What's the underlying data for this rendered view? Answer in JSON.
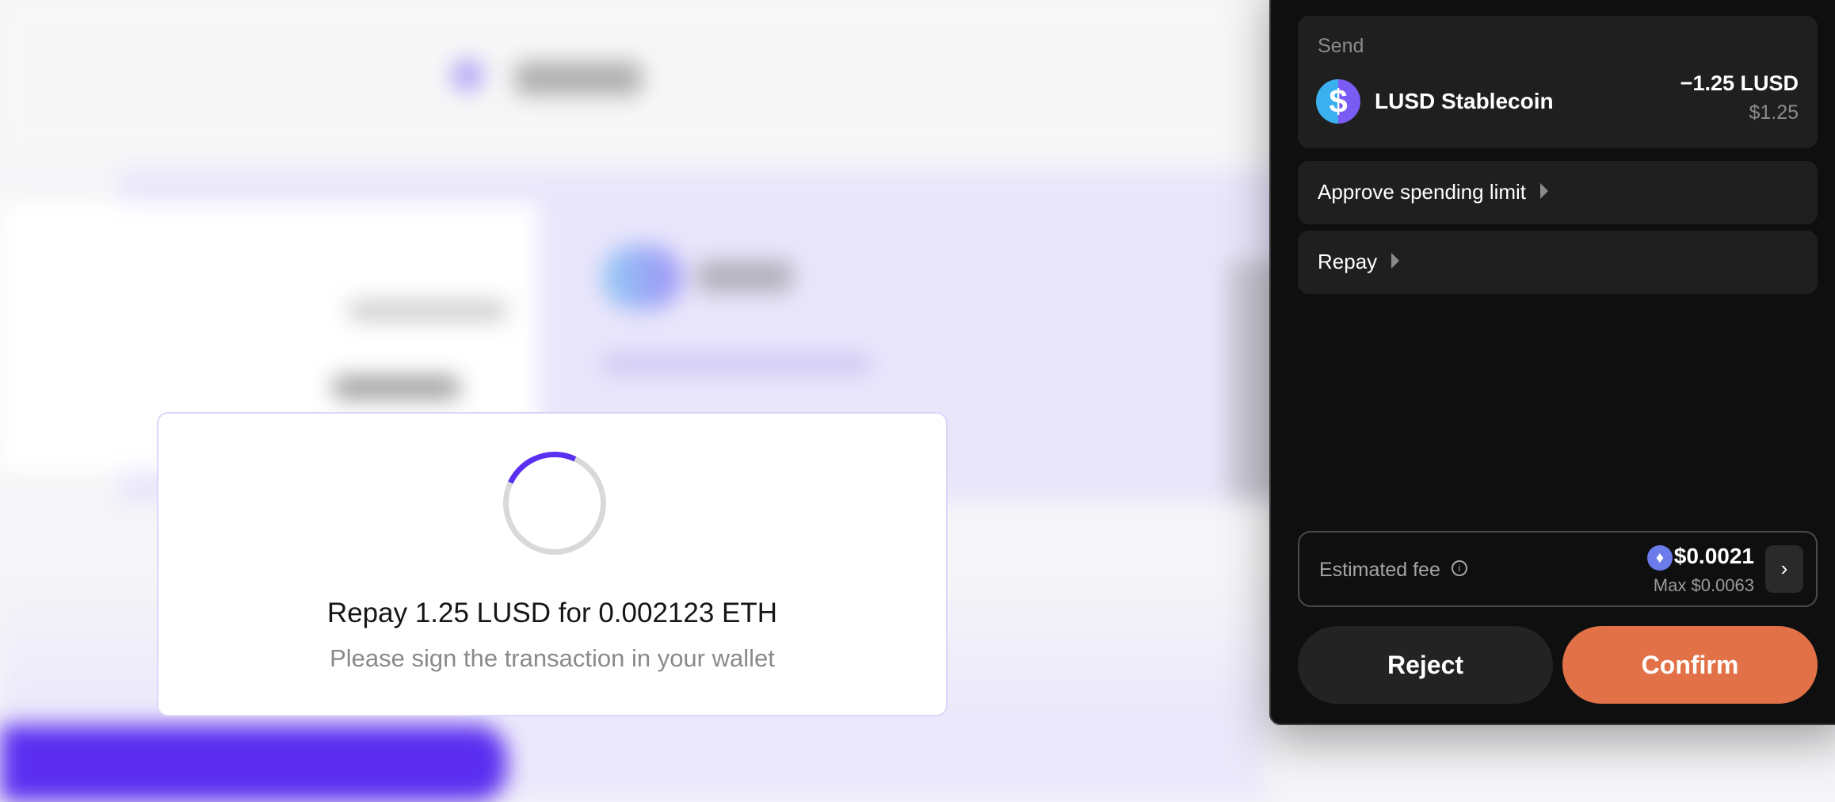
{
  "modal": {
    "title": "Repay 1.25 LUSD for 0.002123 ETH",
    "subtitle": "Please sign the transaction in your wallet"
  },
  "wallet": {
    "send_label": "Send",
    "token": {
      "icon": "dollar-icon",
      "symbol_glyph": "$",
      "name": "LUSD Stablecoin",
      "amount": "−1.25 LUSD",
      "usd": "$1.25"
    },
    "steps": [
      {
        "label": "Approve spending limit"
      },
      {
        "label": "Repay"
      }
    ],
    "fee": {
      "label": "Estimated fee",
      "info_glyph": "i",
      "eth_glyph": "♦",
      "value": "$0.0021",
      "max": "Max $0.0063",
      "expand_glyph": "›"
    },
    "buttons": {
      "reject": "Reject",
      "confirm": "Confirm"
    },
    "colors": {
      "accent": "#e27148",
      "spinner": "#5a2ff0",
      "panel": "#0f0f10"
    }
  }
}
